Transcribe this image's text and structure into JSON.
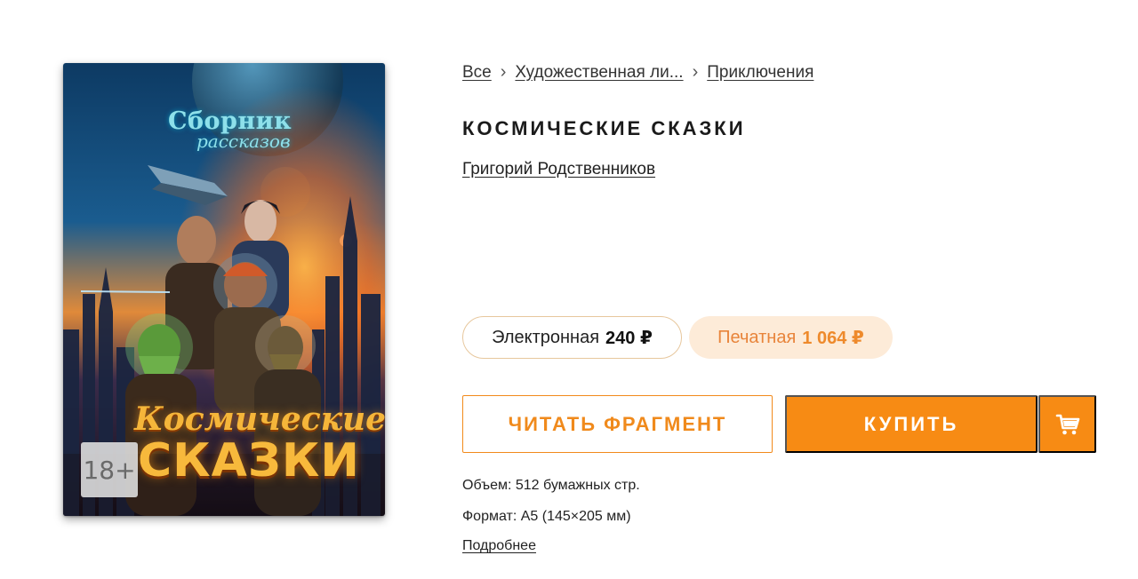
{
  "breadcrumb": {
    "items": [
      "Все",
      "Художественная ли...",
      "Приключения"
    ],
    "separator": "›"
  },
  "book": {
    "title": "КОСМИЧЕСКИЕ СКАЗКИ",
    "author": "Григорий Родственников",
    "age_rating": "18+",
    "cover_series_line1": "Сборник",
    "cover_series_line2": "рассказов",
    "cover_title_line1": "Космические",
    "cover_title_line2": "СКАЗКИ"
  },
  "formats": {
    "ebook": {
      "label": "Электронная",
      "price": "240 ₽"
    },
    "print": {
      "label": "Печатная",
      "price": "1 064 ₽"
    }
  },
  "actions": {
    "read_fragment": "ЧИТАТЬ ФРАГМЕНТ",
    "buy": "КУПИТЬ",
    "cart_icon": "cart-icon"
  },
  "details": {
    "volume": "Объем: 512 бумажных стр.",
    "format": "Формат: А5 (145×205 мм)",
    "more_link": "Подробнее"
  },
  "colors": {
    "accent": "#f78b14",
    "print_pill_bg": "#fdebd8",
    "ebook_pill_border": "#e7c79d"
  }
}
